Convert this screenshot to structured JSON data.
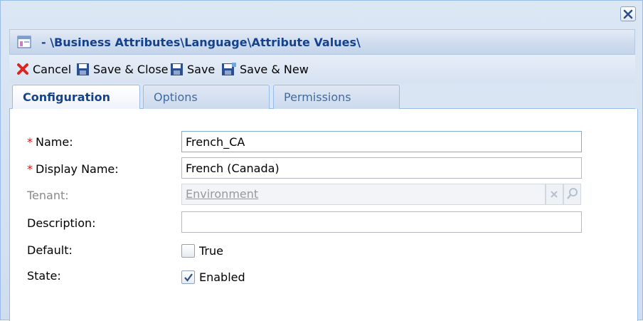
{
  "window": {
    "close_icon": "close-icon",
    "title": "- \\Business Attributes\\Language\\Attribute Values\\",
    "title_icon": "form-window-icon"
  },
  "toolbar": {
    "buttons": [
      {
        "label": "Cancel",
        "icon": "red-x-icon"
      },
      {
        "label": "Save & Close",
        "icon": "floppy-disk-icon"
      },
      {
        "label": "Save",
        "icon": "floppy-disk-icon"
      },
      {
        "label": "Save & New",
        "icon": "floppy-disk-plus-icon"
      }
    ]
  },
  "tabs": [
    {
      "label": "Configuration",
      "active": true
    },
    {
      "label": "Options",
      "active": false
    },
    {
      "label": "Permissions",
      "active": false
    }
  ],
  "form": {
    "required_mark": "*",
    "name": {
      "label": "Name:",
      "value": "French_CA",
      "required": true
    },
    "display_name": {
      "label": "Display Name:",
      "value": "French (Canada)",
      "required": true
    },
    "tenant": {
      "label": "Tenant:",
      "value": "Environment",
      "disabled": true
    },
    "description": {
      "label": "Description:",
      "value": ""
    },
    "default": {
      "label": "Default:",
      "checkbox_label": "True",
      "checked": false
    },
    "state": {
      "label": "State:",
      "checkbox_label": "Enabled",
      "checked": true
    }
  },
  "colors": {
    "title_text": "#15428b",
    "required": "#dd1111",
    "border_accent": "#99bbe8"
  }
}
